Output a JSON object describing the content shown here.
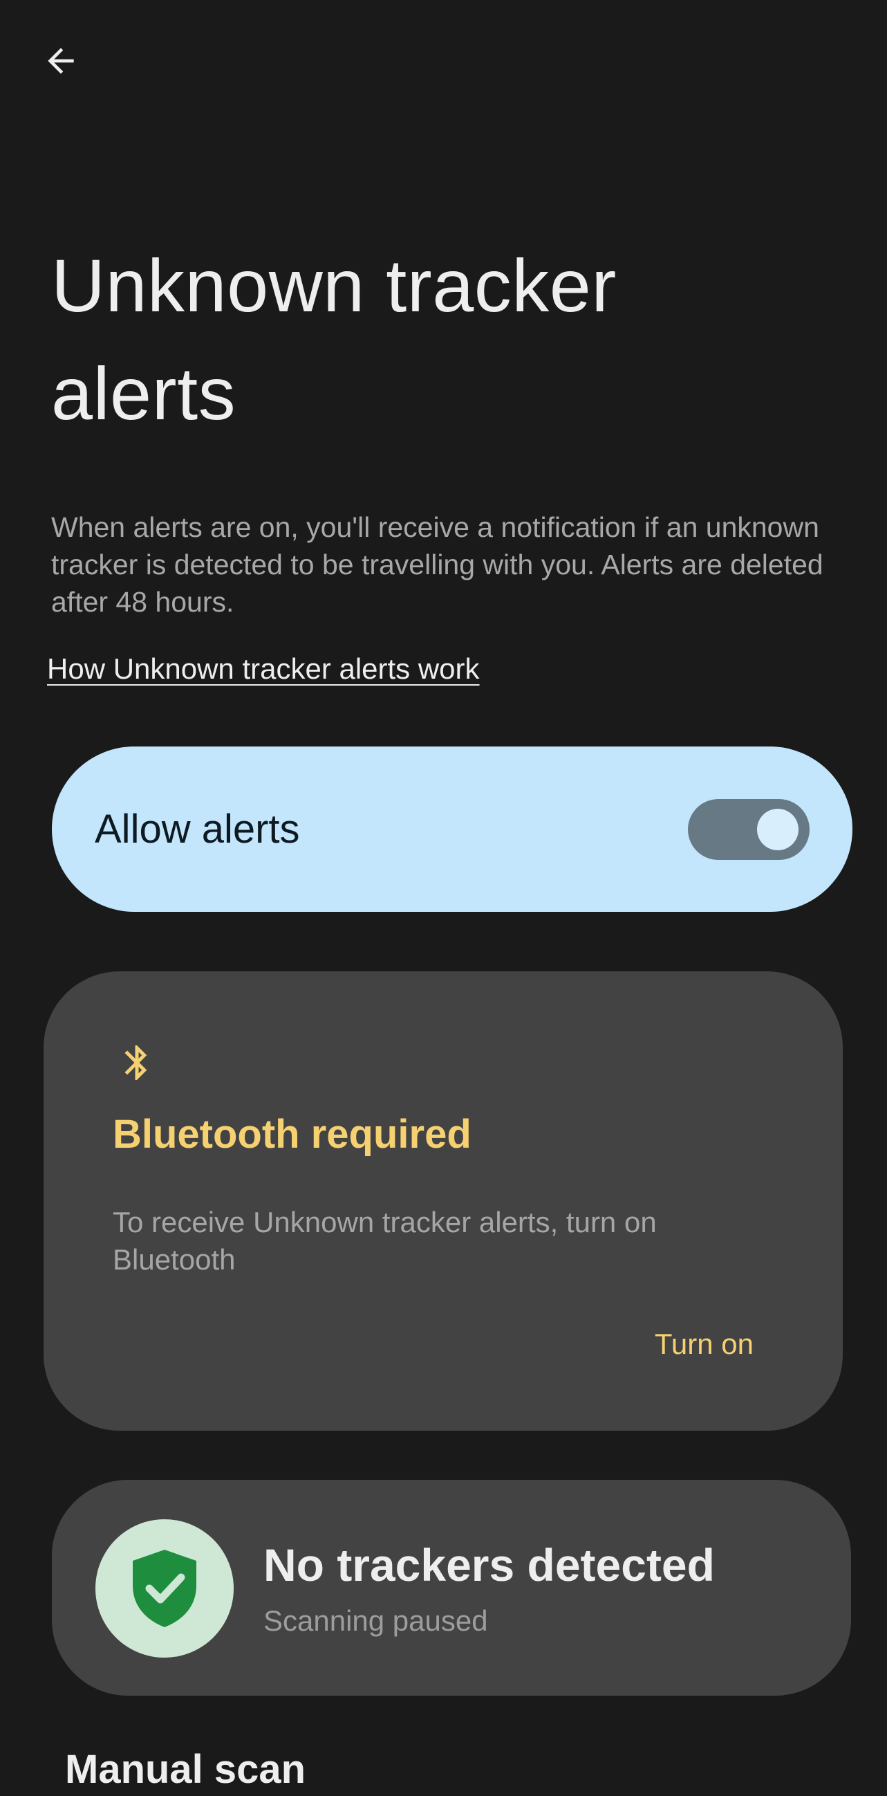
{
  "header": {
    "title": "Unknown tracker alerts",
    "description": "When alerts are on, you'll receive a notification if an unknown tracker is detected to be travelling with you. Alerts are deleted after 48 hours.",
    "learn_more_link": "How Unknown tracker alerts work"
  },
  "allow_alerts": {
    "label": "Allow alerts",
    "enabled": true
  },
  "bluetooth_card": {
    "icon": "bluetooth-icon",
    "title": "Bluetooth required",
    "body": "To receive Unknown tracker alerts, turn on Bluetooth",
    "action_label": "Turn on",
    "accent_color": "#f6d171"
  },
  "status_card": {
    "icon": "shield-check-icon",
    "title": "No trackers detected",
    "subtitle": "Scanning paused",
    "icon_color": "#1e8e3e"
  },
  "manual_scan": {
    "heading": "Manual scan"
  },
  "colors": {
    "background": "#1a1a1b",
    "card": "#434344",
    "allow_card": "#c3e6fd"
  }
}
